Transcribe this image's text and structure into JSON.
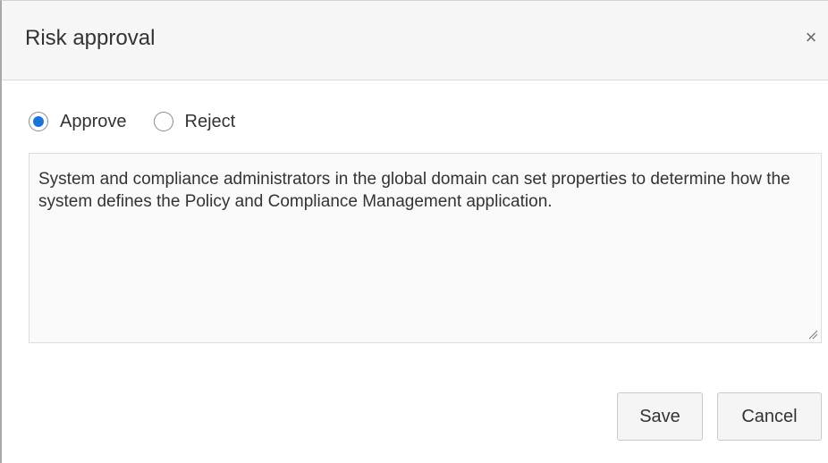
{
  "dialog": {
    "title": "Risk approval",
    "close_symbol": "×"
  },
  "decision": {
    "options": [
      {
        "label": "Approve",
        "checked": true
      },
      {
        "label": "Reject",
        "checked": false
      }
    ]
  },
  "comment": {
    "value": "System and compliance administrators in the global domain can set properties to determine how the system defines the Policy and Compliance Management application."
  },
  "buttons": {
    "save_label": "Save",
    "cancel_label": "Cancel"
  },
  "colors": {
    "radio_accent": "#1a73d9",
    "header_bg": "#f7f7f7",
    "textarea_bg": "#fafafa"
  },
  "icons": {
    "close": "close-icon",
    "resize": "resize-grip-icon"
  }
}
